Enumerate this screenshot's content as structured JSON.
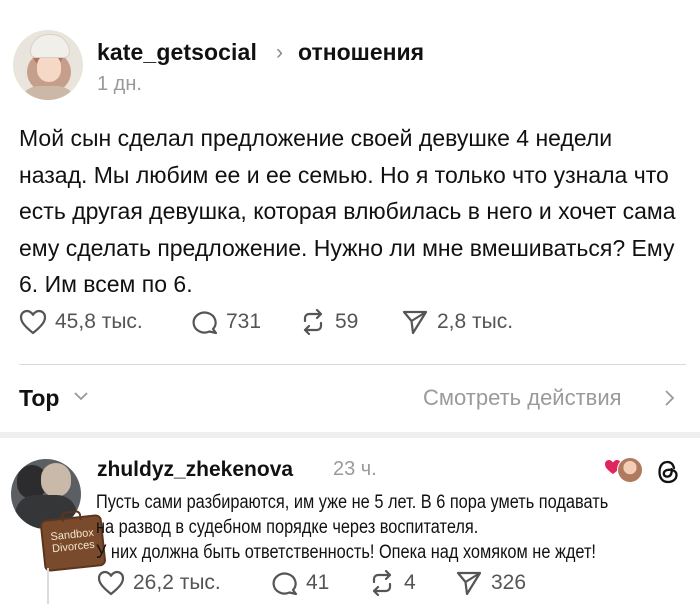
{
  "post": {
    "username": "kate_getsocial",
    "topic": "отношения",
    "time": "1 дн.",
    "text": "Мой сын сделал предложение своей девушке 4 недели назад. Мы любим ее и ее семью. Но я только что узнала что есть другая девушка, которая влюбилась в него и хочет сама ему сделать предложение. Нужно ли мне вмешиваться? Ему 6. Им всем по 6.",
    "likes": "45,8 тыс.",
    "replies": "731",
    "reposts": "59",
    "shares": "2,8 тыс."
  },
  "sort": {
    "label": "Top",
    "view_activity": "Смотреть действия"
  },
  "comment": {
    "username": "zhuldyz_zhekenova",
    "time": "23 ч.",
    "badge_text": "Sandbox Divorces",
    "lines": [
      "Пусть сами разбираются, им уже не 5 лет. В 6 пора уметь подавать",
      "на развод в судебном порядке через воспитателя.",
      "У них должна быть ответственность! Опека над хомяком не ждет!"
    ],
    "likes": "26,2 тыс.",
    "replies": "41",
    "reposts": "4",
    "shares": "326"
  },
  "colors": {
    "text": "#111111",
    "muted": "#9a9a9a",
    "icon": "#555555",
    "like_heart": "#e0245e"
  },
  "icons": [
    "chevron-right-icon",
    "heart-icon",
    "comment-icon",
    "repost-icon",
    "share-icon",
    "chevron-down-icon",
    "threads-icon"
  ]
}
